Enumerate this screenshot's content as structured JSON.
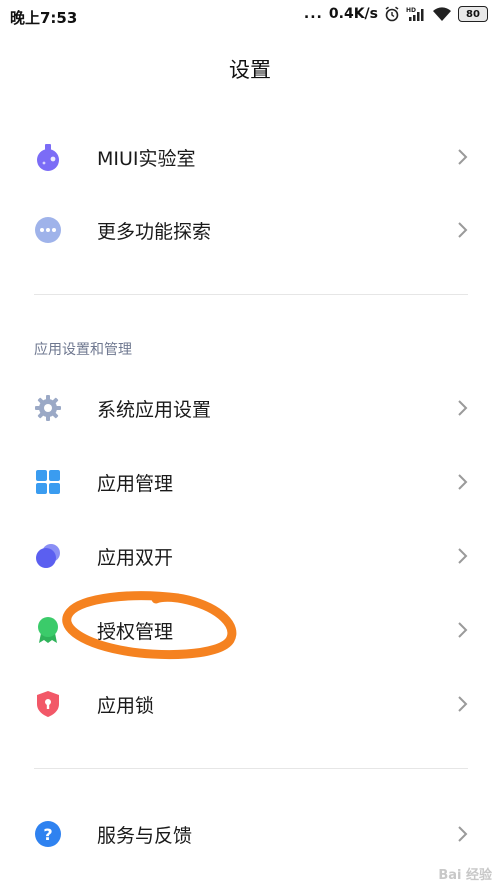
{
  "status_bar": {
    "time": "晚上7:53",
    "dots": "...",
    "speed": "0.4K/s",
    "battery": "80",
    "icons": [
      "alarm-icon",
      "hd-signal-icon",
      "wifi-icon",
      "battery-icon"
    ]
  },
  "page": {
    "title": "设置"
  },
  "groups": {
    "top": [
      {
        "label": "MIUI实验室",
        "icon": "flask-icon",
        "color": "#7b6cf6"
      },
      {
        "label": "更多功能探索",
        "icon": "more-dots-icon",
        "color": "#9fb3ea"
      }
    ],
    "apps": {
      "header": "应用设置和管理",
      "items": [
        {
          "label": "系统应用设置",
          "icon": "gear-icon",
          "color": "#9ba9c6"
        },
        {
          "label": "应用管理",
          "icon": "grid-icon",
          "color": "#3a9cf0"
        },
        {
          "label": "应用双开",
          "icon": "dual-circle-icon",
          "color": "#5b5ff0"
        },
        {
          "label": "授权管理",
          "icon": "badge-icon",
          "color": "#3bcb6a"
        },
        {
          "label": "应用锁",
          "icon": "shield-lock-icon",
          "color": "#f25868"
        }
      ]
    },
    "bottom": [
      {
        "label": "服务与反馈",
        "icon": "help-icon",
        "color": "#2f82f0"
      }
    ]
  },
  "colors": {
    "annotation": "#f58220",
    "chevron": "#9a9a9a",
    "divider": "#e6e6e6"
  },
  "watermark": "Bai 经验"
}
